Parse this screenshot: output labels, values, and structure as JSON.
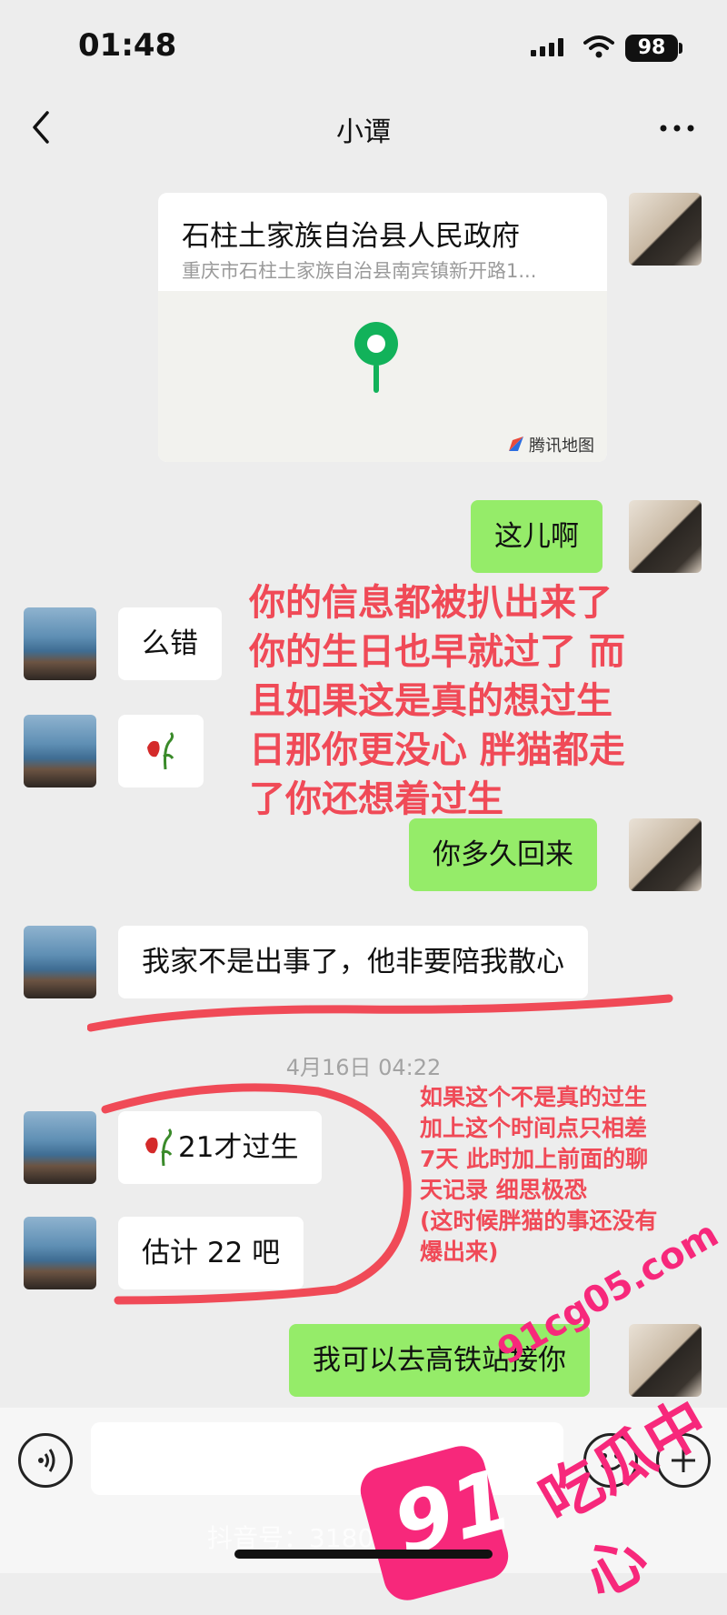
{
  "status_bar": {
    "time": "01:48",
    "battery": "98"
  },
  "nav": {
    "title": "小谭"
  },
  "location_card": {
    "title": "石柱土家族自治县人民政府",
    "address": "重庆市石柱土家族自治县南宾镇新开路1...",
    "map_provider": "腾讯地图"
  },
  "messages": [
    {
      "side": "right",
      "text": "这儿啊"
    },
    {
      "side": "left",
      "text": "么错"
    },
    {
      "side": "left",
      "emoji": "wilted-rose"
    },
    {
      "side": "right",
      "text": "你多久回来"
    },
    {
      "side": "left",
      "text": "我家不是出事了，他非要陪我散心"
    },
    {
      "side": "left",
      "text": "21才过生",
      "emoji": "wilted-rose"
    },
    {
      "side": "left",
      "text": "估计 22 吧"
    },
    {
      "side": "right",
      "text": "我可以去高铁站接你"
    }
  ],
  "timestamp": "4月16日 04:22",
  "annotations": {
    "main": [
      "你的信息都被扒出来了",
      "你的生日也早就过了 而",
      "且如果这是真的想过生",
      "日那你更没心 胖猫都走",
      "了你还想着过生"
    ],
    "second": [
      "如果这个不是真的过生",
      "加上这个时间点只相差",
      "7天 此时加上前面的聊",
      "天记录 细思极恐",
      "(这时候胖猫的事还没有",
      "爆出来)"
    ]
  },
  "watermark": {
    "url": "91cg05.com",
    "name": "吃瓜中心",
    "badge": "91",
    "tiktok_id": "抖音号：3180…287"
  },
  "colors": {
    "green_bubble": "#95ec69",
    "annotation_red": "#f04a57",
    "watermark_pink": "#f7287b"
  }
}
